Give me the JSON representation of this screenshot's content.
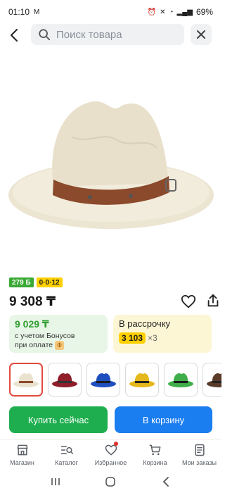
{
  "status_bar": {
    "time": "01:10",
    "battery": "69%"
  },
  "search": {
    "placeholder": "Поиск товара"
  },
  "product": {
    "bonus_badge": "279 Б",
    "installment_badge": "0·0·12",
    "price": "9 308 ₸"
  },
  "bonus_card": {
    "price": "9 029 ₸",
    "text_line1": "с учетом Бонусов",
    "text_line2": "при оплате",
    "chip": "Ф"
  },
  "installment_card": {
    "title": "В рассрочку",
    "amount": "3 103",
    "multiplier": "×3"
  },
  "variants": [
    {
      "name": "beige",
      "color": "#e9e2cf",
      "band": "#8b4a2c"
    },
    {
      "name": "burgundy",
      "color": "#8f1d2a",
      "band": "#333333"
    },
    {
      "name": "blue",
      "color": "#1f4fbf",
      "band": "#1a1a1a"
    },
    {
      "name": "yellow",
      "color": "#e4b81a",
      "band": "#222222"
    },
    {
      "name": "green",
      "color": "#3fae4a",
      "band": "#1a1a1a"
    },
    {
      "name": "brown",
      "color": "#5a3b2a",
      "band": "#222222"
    }
  ],
  "actions": {
    "buy_now": "Купить сейчас",
    "to_cart": "В корзину"
  },
  "bottom_nav": [
    {
      "label": "Магазин",
      "icon": "store-icon"
    },
    {
      "label": "Каталог",
      "icon": "catalog-icon"
    },
    {
      "label": "Избранное",
      "icon": "heart-icon"
    },
    {
      "label": "Корзина",
      "icon": "cart-icon"
    },
    {
      "label": "Мои заказы",
      "icon": "orders-icon"
    }
  ],
  "colors": {
    "accent_green": "#1fae4f",
    "accent_blue": "#1a7df0",
    "installment_yellow": "#ffd000"
  }
}
